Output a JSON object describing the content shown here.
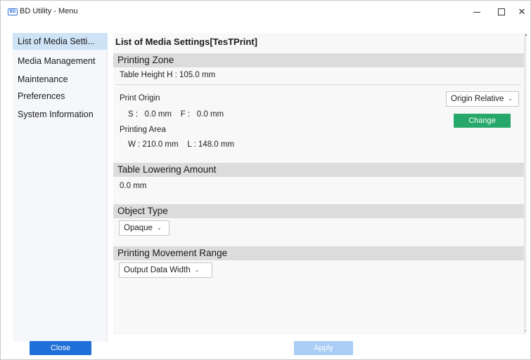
{
  "window": {
    "app_icon_text": "BD",
    "title": "BD Utility - Menu",
    "minimize": "minimize",
    "maximize": "maximize",
    "close_glyph": "✕"
  },
  "sidebar": {
    "items": [
      {
        "label": "List of Media Setti...",
        "selected": true
      },
      {
        "label": "Media Management",
        "selected": false
      },
      {
        "label": "Maintenance",
        "selected": false
      },
      {
        "label": "Preferences",
        "selected": false
      },
      {
        "label": "System Information",
        "selected": false
      }
    ],
    "close_label": "Close"
  },
  "main": {
    "title": "List of Media Settings[TesTPrint]",
    "printing_zone": {
      "header": "Printing Zone",
      "table_height": "Table Height   H : 105.0 mm",
      "print_origin_label": "Print Origin",
      "origin_values": "S :   0.0 mm    F :   0.0 mm",
      "printing_area_label": "Printing Area",
      "area_values": "W : 210.0 mm    L : 148.0 mm",
      "origin_dropdown": "Origin Relative",
      "change_label": "Change"
    },
    "table_lowering": {
      "header": "Table Lowering Amount",
      "value": "0.0 mm"
    },
    "object_type": {
      "header": "Object Type",
      "selected": "Opaque"
    },
    "movement_range": {
      "header": "Printing Movement Range",
      "selected": "Output Data Width"
    },
    "apply_label": "Apply"
  },
  "colors": {
    "sidebar_selected": "#cfe3f7",
    "close_button": "#1f6fd8",
    "change_button": "#27a86a",
    "apply_button_disabled": "#a9cdf5",
    "section_header": "#dcdcdc"
  },
  "icons": [
    "app-icon",
    "minimize-icon",
    "maximize-icon",
    "close-icon",
    "chevron-down-icon"
  ]
}
